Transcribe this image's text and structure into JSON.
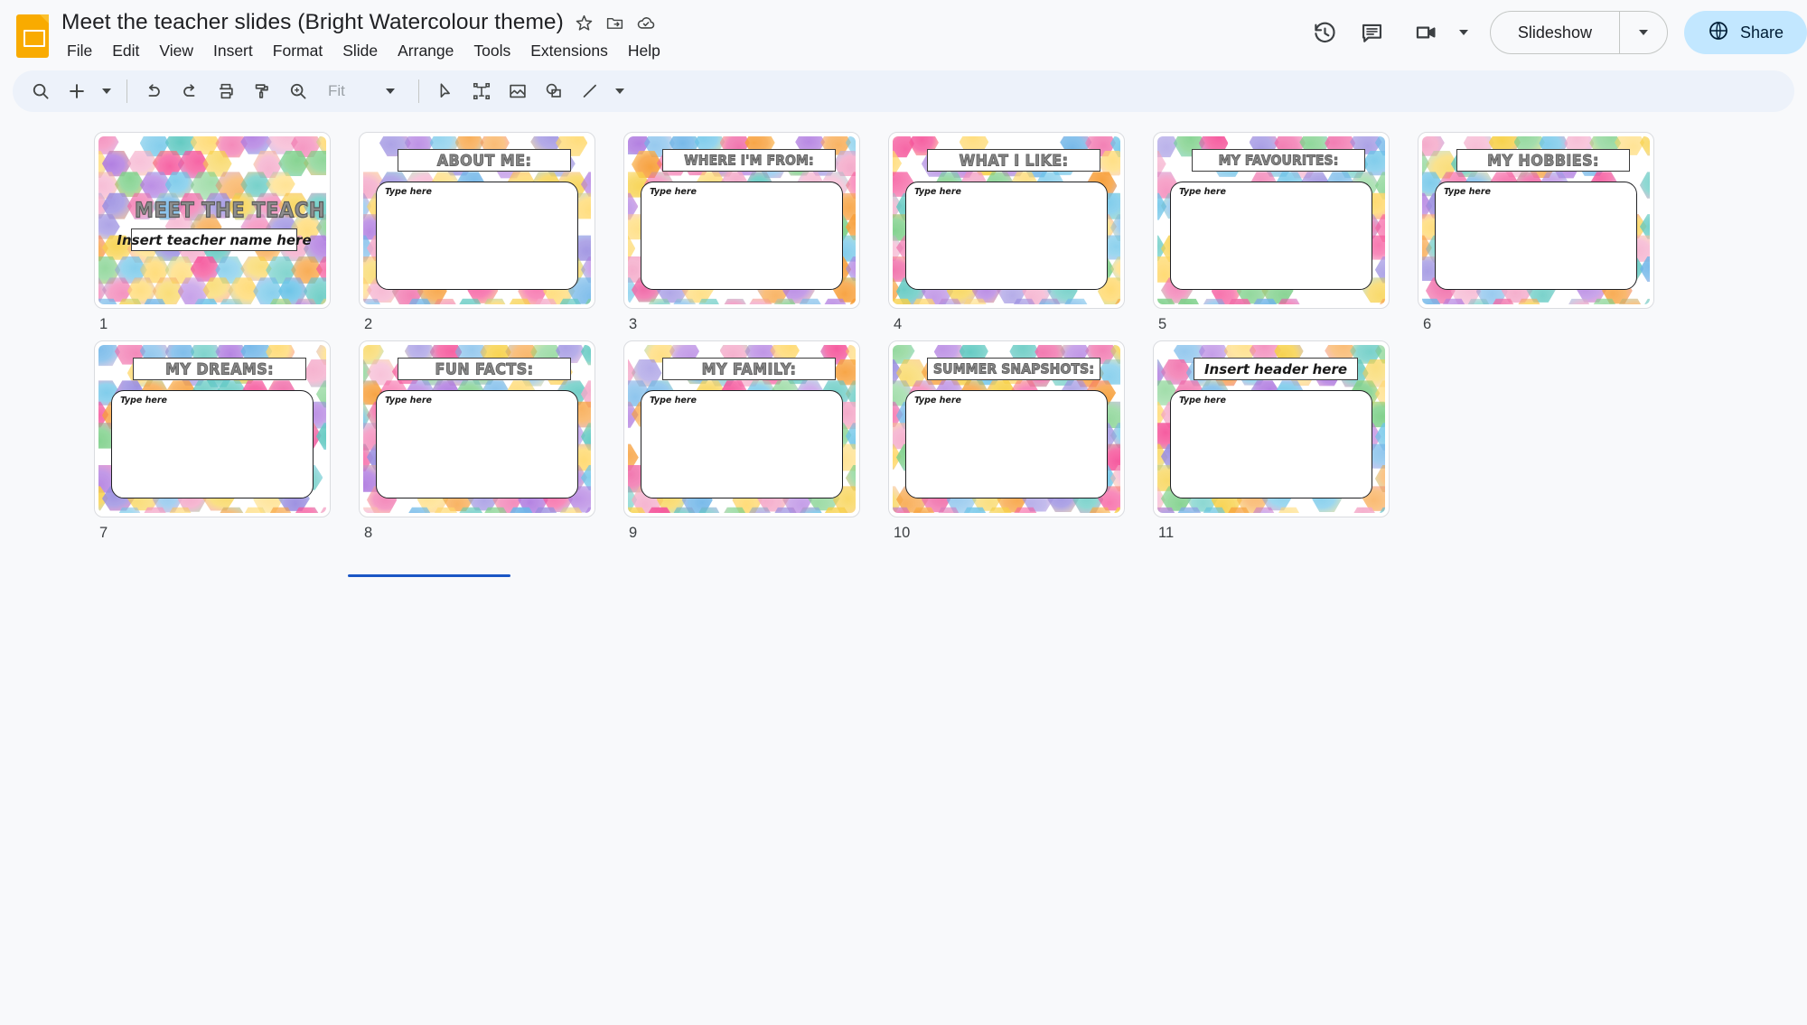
{
  "app": {
    "name": "Google Slides",
    "logo_icon": "slides-logo-icon"
  },
  "header": {
    "doc_title": "Meet the teacher slides (Bright Watercolour theme)",
    "title_icons": [
      {
        "name": "star-icon",
        "label": "Star"
      },
      {
        "name": "move-to-folder-icon",
        "label": "Move"
      },
      {
        "name": "cloud-saved-icon",
        "label": "Saved to Drive"
      }
    ],
    "menus": [
      "File",
      "Edit",
      "View",
      "Insert",
      "Format",
      "Slide",
      "Arrange",
      "Tools",
      "Extensions",
      "Help"
    ],
    "right_icons": [
      {
        "name": "version-history-icon",
        "label": "Version history"
      },
      {
        "name": "comment-icon",
        "label": "Comments"
      },
      {
        "name": "meet-camera-icon",
        "label": "Join a call"
      }
    ],
    "slideshow": {
      "label": "Slideshow",
      "caret_icon": "chevron-down-icon"
    },
    "share": {
      "label": "Share",
      "icon": "globe-icon",
      "bg": "#c2e7ff"
    }
  },
  "toolbar": {
    "items": [
      {
        "name": "search-icon",
        "label": "Search"
      },
      {
        "name": "new-slide-icon",
        "label": "New slide"
      },
      {
        "name": "new-slide-caret-icon",
        "label": "New slide options"
      },
      {
        "name": "undo-icon",
        "label": "Undo"
      },
      {
        "name": "redo-icon",
        "label": "Redo"
      },
      {
        "name": "print-icon",
        "label": "Print"
      },
      {
        "name": "paint-format-icon",
        "label": "Paint format"
      },
      {
        "name": "zoom-icon",
        "label": "Zoom"
      }
    ],
    "zoom_value": "Fit",
    "tools": [
      {
        "name": "select-cursor-icon",
        "label": "Select"
      },
      {
        "name": "text-box-icon",
        "label": "Text box"
      },
      {
        "name": "insert-image-icon",
        "label": "Insert image"
      },
      {
        "name": "shape-icon",
        "label": "Shape"
      },
      {
        "name": "line-icon",
        "label": "Line"
      },
      {
        "name": "line-caret-icon",
        "label": "Line options"
      }
    ]
  },
  "theme": {
    "accent_blue": "#1a56c5",
    "toolbar_bg": "#edf2fa",
    "page_bg": "#f8f9fb",
    "palette": [
      "#f7d046",
      "#f79f3a",
      "#f5559b",
      "#f06ba8",
      "#b07ce0",
      "#6fb5e8",
      "#5ec8c0",
      "#7ed08a",
      "#f4a9c9",
      "#9a8ee0",
      "#ffd86b",
      "#6cc4e8"
    ]
  },
  "slides": [
    {
      "number": "1",
      "layout": "title",
      "title": "MEET THE TEACHER",
      "subtitle": "Insert teacher name here"
    },
    {
      "number": "2",
      "layout": "content",
      "header": "ABOUT ME:",
      "body_placeholder": "Type here"
    },
    {
      "number": "3",
      "layout": "content",
      "header": "WHERE I'M FROM:",
      "body_placeholder": "Type here"
    },
    {
      "number": "4",
      "layout": "content",
      "header": "WHAT I LIKE:",
      "body_placeholder": "Type here"
    },
    {
      "number": "5",
      "layout": "content",
      "header": "MY FAVOURITES:",
      "body_placeholder": "Type here"
    },
    {
      "number": "6",
      "layout": "content",
      "header": "MY HOBBIES:",
      "body_placeholder": "Type here"
    },
    {
      "number": "7",
      "layout": "content",
      "header": "MY DREAMS:",
      "body_placeholder": "Type here"
    },
    {
      "number": "8",
      "layout": "content",
      "header": "FUN FACTS:",
      "body_placeholder": "Type here"
    },
    {
      "number": "9",
      "layout": "content",
      "header": "MY FAMILY:",
      "body_placeholder": "Type here"
    },
    {
      "number": "10",
      "layout": "content",
      "header": "SUMMER SNAPSHOTS:",
      "body_placeholder": "Type here"
    },
    {
      "number": "11",
      "layout": "blank",
      "header": "Insert header here",
      "body_placeholder": "Type here"
    }
  ]
}
